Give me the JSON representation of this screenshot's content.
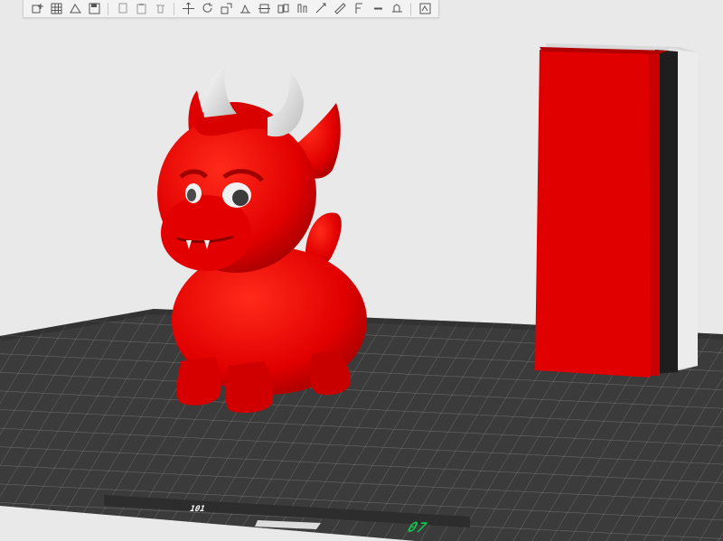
{
  "toolbar": {
    "items": [
      {
        "name": "add-object-icon",
        "kind": "button"
      },
      {
        "name": "arrange-grid-icon",
        "kind": "button"
      },
      {
        "name": "auto-orient-icon",
        "kind": "button"
      },
      {
        "name": "save-icon",
        "kind": "button"
      },
      {
        "kind": "sep"
      },
      {
        "name": "copy-icon",
        "kind": "button"
      },
      {
        "name": "paste-icon",
        "kind": "button"
      },
      {
        "name": "delete-icon",
        "kind": "button"
      },
      {
        "kind": "sep"
      },
      {
        "name": "move-icon",
        "kind": "button"
      },
      {
        "name": "rotate-icon",
        "kind": "button"
      },
      {
        "name": "scale-icon",
        "kind": "button"
      },
      {
        "name": "place-on-face-icon",
        "kind": "button"
      },
      {
        "name": "cut-icon",
        "kind": "button"
      },
      {
        "name": "split-icon",
        "kind": "button"
      },
      {
        "name": "support-paint-icon",
        "kind": "button"
      },
      {
        "name": "seam-paint-icon",
        "kind": "button"
      },
      {
        "name": "measure-icon",
        "kind": "button"
      },
      {
        "name": "emboss-icon",
        "kind": "button"
      },
      {
        "name": "simplify-icon",
        "kind": "button"
      },
      {
        "name": "assembly-icon",
        "kind": "button"
      },
      {
        "kind": "sep"
      },
      {
        "name": "variable-layer-icon",
        "kind": "button"
      }
    ]
  },
  "bed": {
    "label": "07",
    "corner_mark": "101"
  },
  "colors": {
    "background": "#e9e9e9",
    "bed_plate": "#3a3a3a",
    "bed_grid": "#6a6a6a",
    "model_red": "#e60000",
    "horn": "#eeeeee",
    "tower_dark": "#1e1e1e",
    "tower_white": "#d8d8d8",
    "label_green": "#11c34a"
  }
}
